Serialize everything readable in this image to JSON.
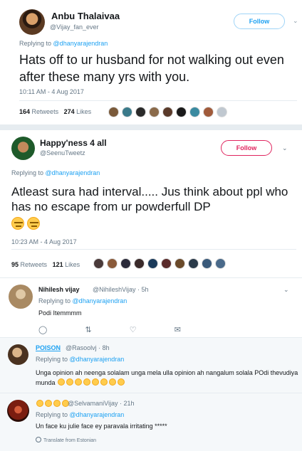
{
  "tweet1": {
    "name": "Anbu Thalaivaa",
    "handle": "@Vijay_fan_ever",
    "follow_label": "Follow",
    "replying_prefix": "Replying to",
    "replying_handle": "@dhanyarajendran",
    "text": "Hats off to ur husband for not walking out even after these many yrs with you.",
    "timestamp": "10:11 AM - 4 Aug 2017",
    "retweets_count": "164",
    "retweets_label": "Retweets",
    "likes_count": "274",
    "likes_label": "Likes",
    "face_colors": [
      "#7a5a3a",
      "#3a7a8a",
      "#2a2a2a",
      "#8a6a4a",
      "#5a3a2a",
      "#1a1a1a",
      "#3a8aa0",
      "#a05a3a",
      "#c0c8d0"
    ]
  },
  "tweet2": {
    "name": "Happy'ness 4 all",
    "handle": "@SeenuTweetz",
    "follow_label": "Follow",
    "replying_prefix": "Replying to",
    "replying_handle": "@dhanyarajendran",
    "text": "Atleast sura had interval..... Jus think about ppl who has no escape from ur powderfull DP",
    "timestamp": "10:23 AM - 4 Aug 2017",
    "retweets_count": "95",
    "retweets_label": "Retweets",
    "likes_count": "121",
    "likes_label": "Likes",
    "face_colors": [
      "#4a3a3a",
      "#8a5a3a",
      "#2a2a3a",
      "#3a2a2a",
      "#1a3a5a",
      "#5a2a2a",
      "#6a4a2a",
      "#2a3a4a",
      "#3a5a7a",
      "#4a6a8a"
    ]
  },
  "reply1": {
    "name": "Nihilesh vijay",
    "handle": "@NihileshVijay · 5h",
    "replying_prefix": "Replying to",
    "replying_handle": "@dhanyarajendran",
    "text": "Podi Itemmmm"
  },
  "reply2": {
    "name": "POISON",
    "handle": "@Rasoolvj · 8h",
    "replying_prefix": "Replying to",
    "replying_handle": "@dhanyarajendran",
    "text": "Unga opinion ah neenga solalam unga mela ulla opinion ah nangalum solala POdi thevudiya munda"
  },
  "reply3": {
    "name": "",
    "handle": "@SelvamaniVijay · 21h",
    "replying_prefix": "Replying to",
    "replying_handle": "@dhanyarajendran",
    "text": "Un face ku julie face ey paravala irritating *****",
    "translate": "Translate from Estonian"
  }
}
